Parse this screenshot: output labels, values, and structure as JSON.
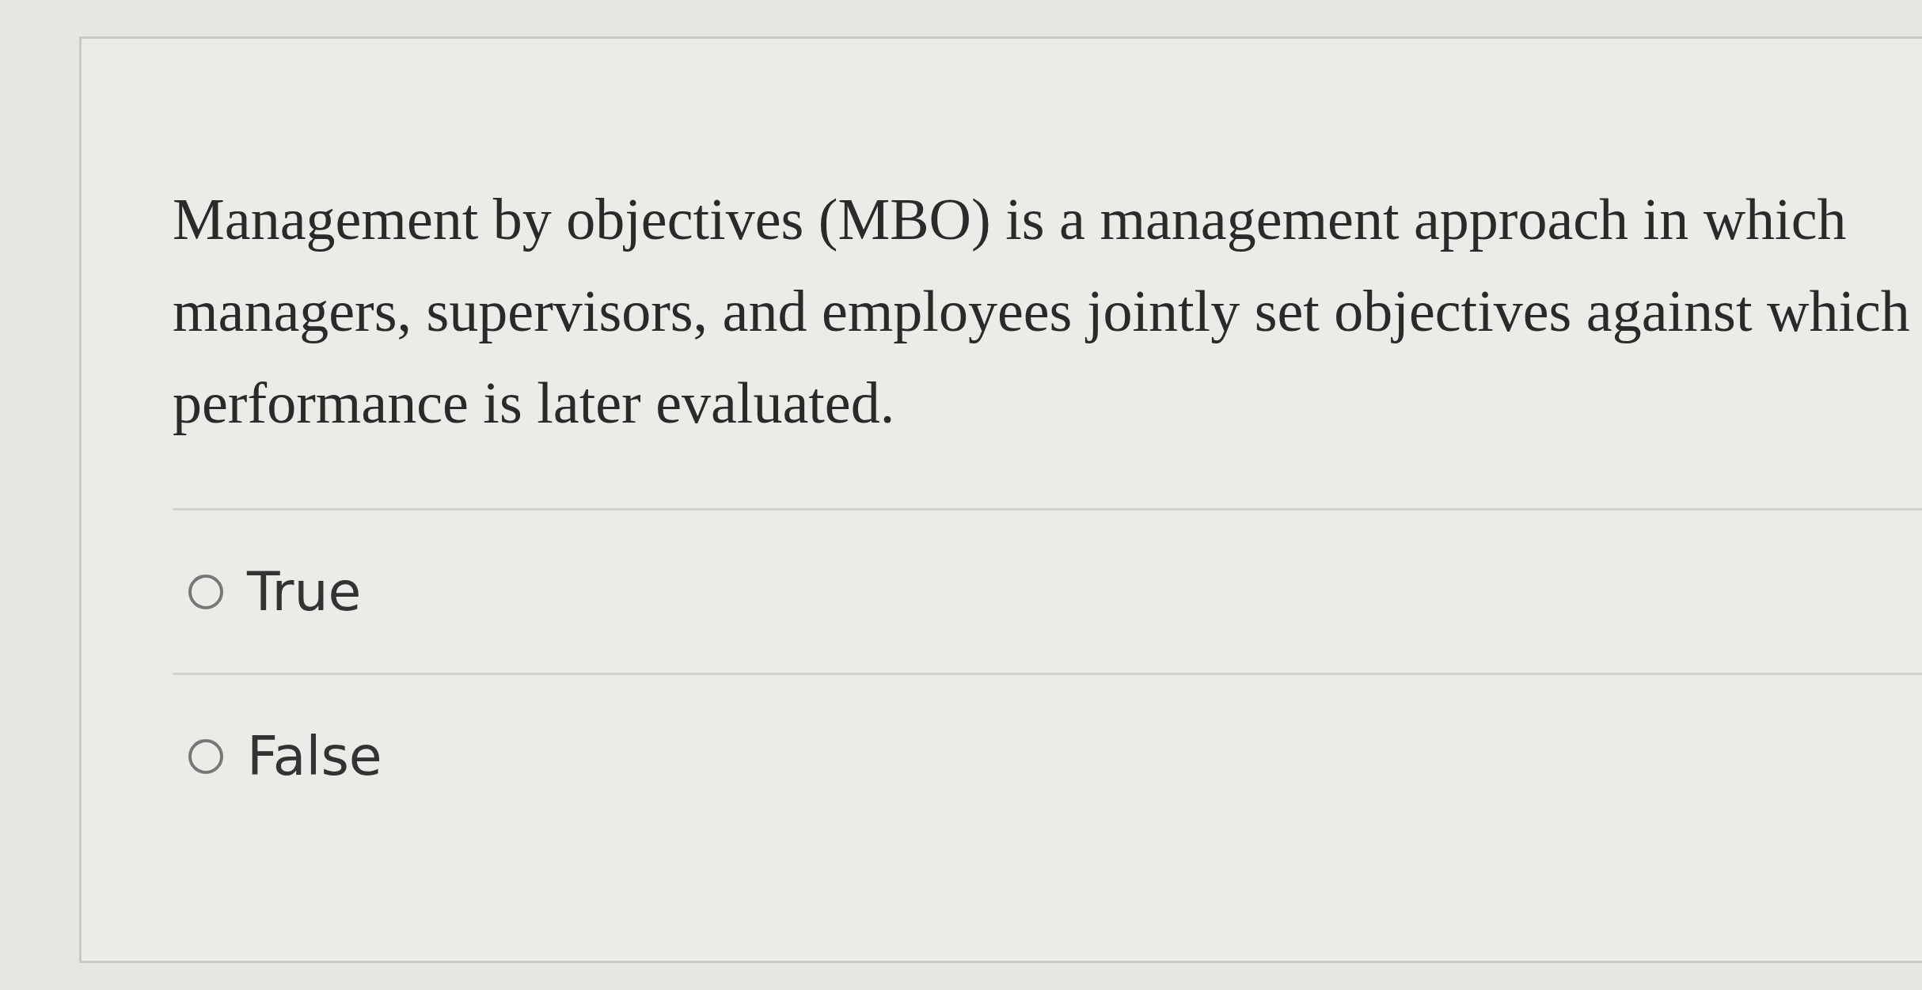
{
  "question": {
    "text": "Management by objectives (MBO) is a management approach in which managers, supervisors, and employees jointly set objectives against which performance is later evaluated."
  },
  "options": [
    {
      "label": "True",
      "selected": false
    },
    {
      "label": "False",
      "selected": false
    }
  ]
}
